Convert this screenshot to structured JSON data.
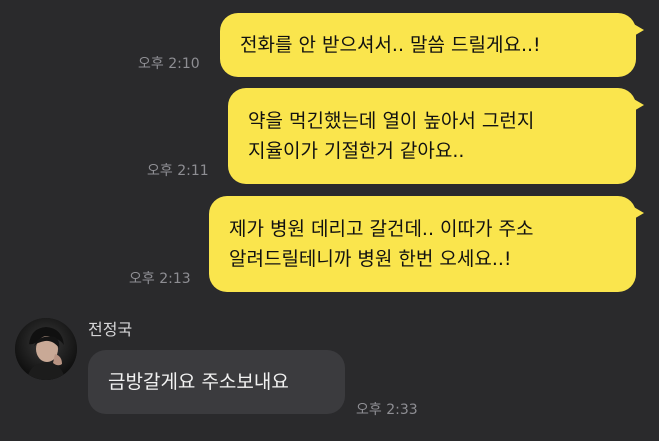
{
  "messages": [
    {
      "id": "m1",
      "direction": "outgoing",
      "text_lines": [
        "전화를 안 받으셔서.. 말씀 드릴게요..!"
      ],
      "time": "오후 2:10"
    },
    {
      "id": "m2",
      "direction": "outgoing",
      "text_lines": [
        "약을 먹긴했는데 열이 높아서 그런지",
        "지율이가 기절한거 같아요.."
      ],
      "time": "오후 2:11"
    },
    {
      "id": "m3",
      "direction": "outgoing",
      "text_lines": [
        "제가 병원 데리고 갈건데.. 이따가 주소",
        "알려드릴테니까 병원 한번 오세요..!"
      ],
      "time": "오후 2:13"
    },
    {
      "id": "m4",
      "direction": "incoming",
      "sender": "전정국",
      "avatar_icon": "profile-photo",
      "text_lines": [
        "금방갈게요 주소보내요"
      ],
      "time": "오후 2:33"
    }
  ],
  "colors": {
    "background": "#2a2a2c",
    "outgoing_bubble": "#fae54d",
    "incoming_bubble": "#3b3b3e",
    "timestamp": "#8e8e93"
  }
}
